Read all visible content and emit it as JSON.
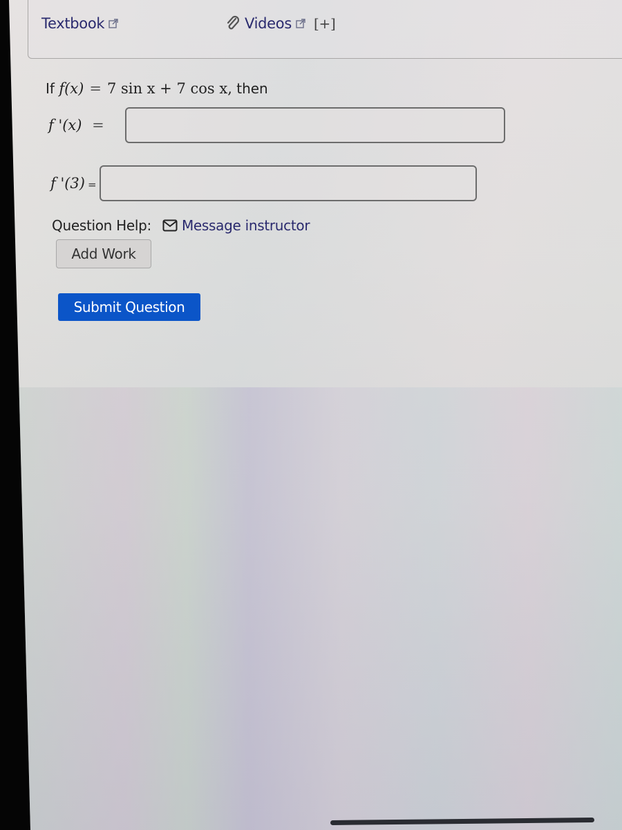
{
  "resources": {
    "textbook_label": "Textbook",
    "videos_label": "Videos",
    "expand_label": "[+]",
    "icons": {
      "external_link": "external-link-icon",
      "attachment": "paperclip-icon"
    }
  },
  "question": {
    "intro": "If",
    "function_lhs": "f(x)",
    "equals": "=",
    "function_rhs": "7 sin x + 7 cos x,",
    "suffix": "then",
    "answers": [
      {
        "label": "f '(x)",
        "equals": "=",
        "value": "",
        "placeholder": ""
      },
      {
        "label": "f '(3)",
        "equals": "=",
        "value": "",
        "placeholder": ""
      }
    ]
  },
  "help": {
    "label": "Question Help:",
    "message_link": "Message instructor",
    "icon": "mail-icon"
  },
  "buttons": {
    "add_work": "Add Work",
    "submit": "Submit Question"
  },
  "colors": {
    "link": "#2a2a6e",
    "submit_bg": "#0b55c8",
    "add_work_bg": "#d6d4d3",
    "text": "#222222"
  }
}
